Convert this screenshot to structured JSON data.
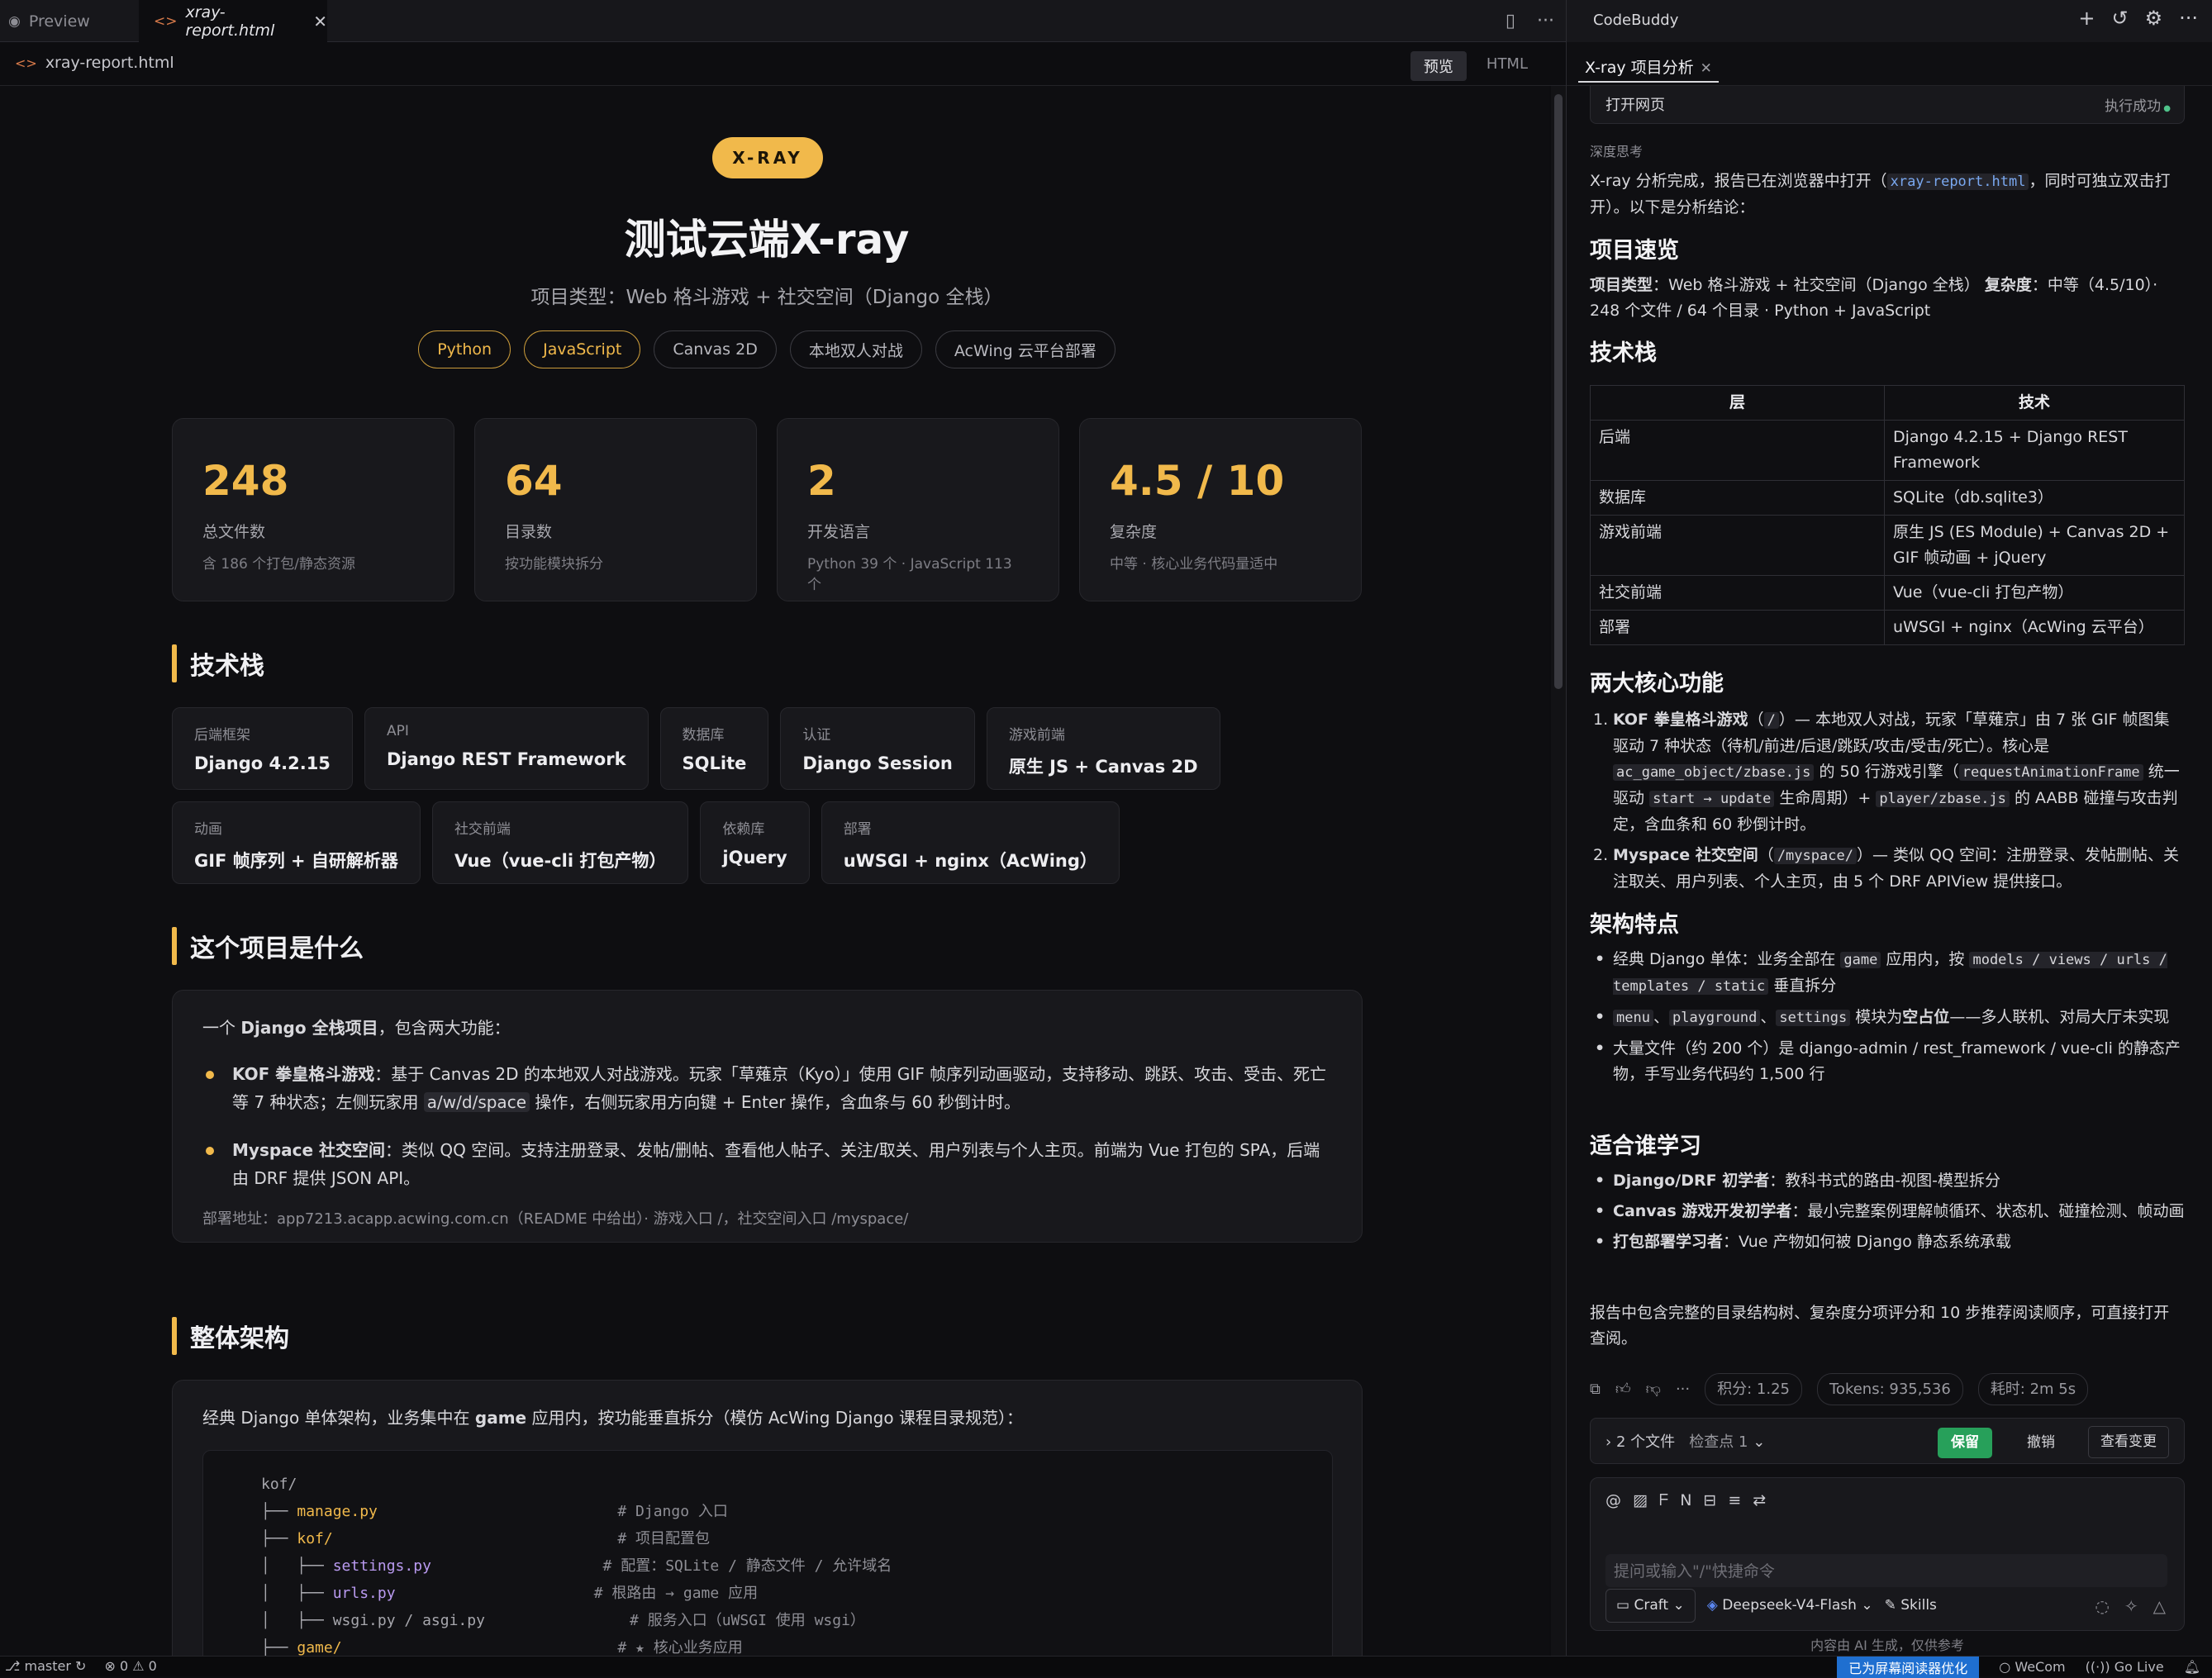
{
  "tabs": [
    {
      "label": "Preview",
      "icon": "eye-icon"
    },
    {
      "label": "xray-report.html",
      "icon": "code-icon",
      "active": true
    }
  ],
  "path": "xray-report.html",
  "view_toggle": {
    "preview": "预览",
    "html": "HTML"
  },
  "report": {
    "badge": "X-RAY",
    "title": "测试云端X-ray",
    "subtitle": "项目类型：Web 格斗游戏 + 社交空间（Django 全栈）",
    "chips": [
      {
        "label": "Python",
        "highlight": true
      },
      {
        "label": "JavaScript",
        "highlight": true
      },
      {
        "label": "Canvas 2D",
        "highlight": false
      },
      {
        "label": "本地双人对战",
        "highlight": false
      },
      {
        "label": "AcWing 云平台部署",
        "highlight": false
      }
    ],
    "stats": [
      {
        "value": "248",
        "label": "总文件数",
        "sub": "含 186 个打包/静态资源"
      },
      {
        "value": "64",
        "label": "目录数",
        "sub": "按功能模块拆分"
      },
      {
        "value": "2",
        "label": "开发语言",
        "sub": "Python 39 个 · JavaScript 113 个"
      },
      {
        "value": "4.5 / 10",
        "label": "复杂度",
        "sub": "中等 · 核心业务代码量适中"
      }
    ],
    "sections": {
      "tech": "技术栈",
      "what": "这个项目是什么",
      "arch": "整体架构"
    },
    "tech_items": [
      {
        "k": "后端框架",
        "v": "Django 4.2.15"
      },
      {
        "k": "API",
        "v": "Django REST Framework"
      },
      {
        "k": "数据库",
        "v": "SQLite"
      },
      {
        "k": "认证",
        "v": "Django Session"
      },
      {
        "k": "游戏前端",
        "v": "原生 JS + Canvas 2D"
      },
      {
        "k": "动画",
        "v": "GIF 帧序列 + 自研解析器"
      },
      {
        "k": "社交前端",
        "v": "Vue（vue-cli 打包产物）"
      },
      {
        "k": "依赖库",
        "v": "jQuery"
      },
      {
        "k": "部署",
        "v": "uWSGI + nginx（AcWing）"
      }
    ],
    "what": {
      "intro_pre": "一个 ",
      "intro_bold": "Django 全栈项目",
      "intro_post": "，包含两大功能：",
      "b1_bold": "KOF 拳皇格斗游戏",
      "b1_pre": "：基于 Canvas 2D 的本地双人对战游戏。玩家「草薙京（Kyo）」使用 GIF 帧序列动画驱动，支持移动、跳跃、攻击、受击、死亡等 7 种状态；左侧玩家用 ",
      "b1_code": "a/w/d/space",
      "b1_post": " 操作，右侧玩家用方向键 + Enter 操作，含血条与 60 秒倒计时。",
      "b2_bold": "Myspace 社交空间",
      "b2_text": "：类似 QQ 空间。支持注册登录、发帖/删帖、查看他人帖子、关注/取关、用户列表与个人主页。前端为 Vue 打包的 SPA，后端由 DRF 提供 JSON API。",
      "deploy": "部署地址：app7213.acapp.acwing.com.cn（README 中给出）· 游戏入口 /，社交空间入口 /myspace/"
    },
    "arch": {
      "intro_pre": "经典 Django 单体架构，业务集中在 ",
      "intro_bold": "game",
      "intro_post": " 应用内，按功能垂直拆分（模仿 AcWing Django 课程目录规范）：",
      "tree": [
        {
          "t": "kof/",
          "cls": "",
          "c": ""
        },
        {
          "t": "├── ",
          "name": "manage.py",
          "cls": "y",
          "c": "# Django 入口"
        },
        {
          "t": "├── ",
          "name": "kof/",
          "cls": "y",
          "c": "# 项目配置包"
        },
        {
          "t": "│   ├── ",
          "name": "settings.py",
          "cls": "pu",
          "c": " # 配置：SQLite / 静态文件 / 允许域名"
        },
        {
          "t": "│   ├── ",
          "name": "urls.py",
          "cls": "pu",
          "c": "# 根路由 → game 应用"
        },
        {
          "t": "│   ├── ",
          "name": "wsgi.py / asgi.py",
          "cls": "",
          "c": "    # 服务入口（uWSGI 使用 wsgi）"
        },
        {
          "t": "├── ",
          "name": "game/",
          "cls": "y",
          "c": "# ★ 核心业务应用"
        }
      ]
    }
  },
  "assistant": {
    "app_name": "CodeBuddy",
    "tab": "X-ray 项目分析",
    "tool_bar": {
      "action": "打开网页",
      "status": "执行成功"
    },
    "thinking": "深度思考",
    "intro_pre": "X-ray 分析完成，报告已在浏览器中打开（",
    "intro_link": "xray-report.html",
    "intro_post": "，同时可独立双击打开）。以下是分析结论：",
    "h_overview": "项目速览",
    "overview_l1_k1": "项目类型",
    "overview_l1_v1": "：Web 格斗游戏 + 社交空间（Django 全栈）",
    "overview_l1_k2": "复杂度",
    "overview_l1_v2": "：中等（4.5/10）·",
    "overview_l2": "248 个文件 / 64 个目录 · Python + JavaScript",
    "h_tech": "技术栈",
    "table_headers": [
      "层",
      "技术"
    ],
    "table_rows": [
      [
        "后端",
        "Django 4.2.15 + Django REST Framework"
      ],
      [
        "数据库",
        "SQLite（db.sqlite3）"
      ],
      [
        "游戏前端",
        "原生 JS (ES Module) + Canvas 2D + GIF 帧动画 + jQuery"
      ],
      [
        "社交前端",
        "Vue（vue-cli 打包产物）"
      ],
      [
        "部署",
        "uWSGI + nginx（AcWing 云平台）"
      ]
    ],
    "h_core": "两大核心功能",
    "core1": {
      "bold": "KOF 拳皇格斗游戏",
      "code1": "/",
      "t1": "— 本地双人对战，玩家「草薙京」由 7 张 GIF 帧图集驱动 7 种状态（待机/前进/后退/跳跃/攻击/受击/死亡）。核心是",
      "code2": "ac_game_object/zbase.js",
      "t2": "的 50 行游戏引擎（",
      "code3": "requestAnimationFrame",
      "t3": "统一驱动",
      "code4": "start → update",
      "t4": "生命周期）+",
      "code5": "player/zbase.js",
      "t5": "的 AABB 碰撞与攻击判定，含血条和 60 秒倒计时。"
    },
    "core2": {
      "bold": "Myspace 社交空间",
      "code1": "/myspace/",
      "t1": "— 类似 QQ 空间：注册登录、发帖删帖、关注取关、用户列表、个人主页，由 5 个 DRF APIView 提供接口。"
    },
    "h_arch": "架构特点",
    "arch1_pre": "经典 Django 单体：业务全部在",
    "arch1_code1": "game",
    "arch1_mid": "应用内，按",
    "arch1_code2": "models / views / urls / templates / static",
    "arch1_post": "垂直拆分",
    "arch2_code1": "menu",
    "arch2_code2": "playground",
    "arch2_code3": "settings",
    "arch2_mid": "模块为",
    "arch2_bold": "空占位",
    "arch2_post": "——多人联机、对局大厅未实现",
    "arch3": "大量文件（约 200 个）是 django-admin / rest_framework / vue-cli 的静态产物，手写业务代码约 1,500 行",
    "h_who": "适合谁学习",
    "who": [
      {
        "b": "Django/DRF 初学者",
        "t": "：教科书式的路由-视图-模型拆分"
      },
      {
        "b": "Canvas 游戏开发初学者",
        "t": "：最小完整案例理解帧循环、状态机、碰撞检测、帧动画"
      },
      {
        "b": "打包部署学习者",
        "t": "：Vue 产物如何被 Django 静态系统承载"
      }
    ],
    "closing": "报告中包含完整的目录结构树、复杂度分项评分和 10 步推荐阅读顺序，可直接打开查阅。",
    "metrics": {
      "points": "积分: 1.25",
      "tokens": "Tokens: 935,536",
      "time": "耗时: 2m 5s"
    },
    "files": {
      "label": "2 个文件",
      "checkpoint": "检查点 1",
      "keep": "保留",
      "undo": "撤销",
      "review": "查看变更"
    },
    "input_placeholder": "提问或输入\"/\"快捷命令",
    "mode": "Craft",
    "model": "Deepseek-V4-Flash",
    "skills": "Skills",
    "footer": "内容由 AI 生成，仅供参考"
  },
  "statusbar": {
    "branch": "master",
    "problems": "⊗ 0 ⚠ 0",
    "accessibility": "已为屏幕阅读器优化",
    "wecom": "WeCom",
    "golive": "Go Live"
  }
}
